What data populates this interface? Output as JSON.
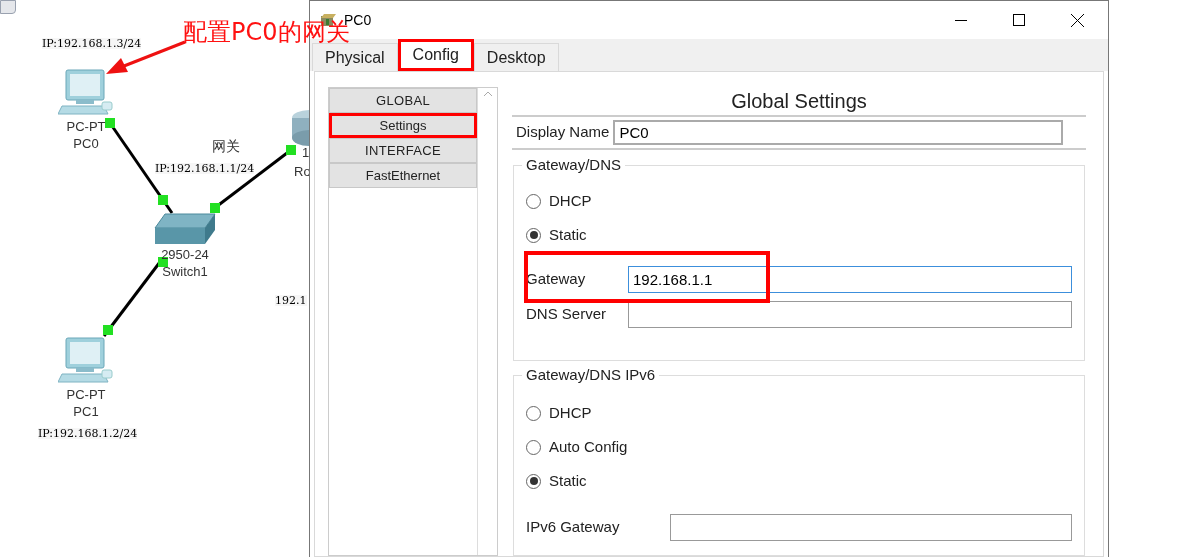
{
  "topology": {
    "annotation": "配置PC0的网关",
    "gateway_label": "网关",
    "gateway_ip": "IP:192.168.1.1/24",
    "devices": [
      {
        "kind": "pc",
        "model": "PC-PT",
        "name": "PC0",
        "ip": "IP:192.168.1.3/24"
      },
      {
        "kind": "switch",
        "model": "2950-24",
        "name": "Switch1"
      },
      {
        "kind": "pc",
        "model": "PC-PT",
        "name": "PC1",
        "ip": "IP:192.168.1.2/24"
      },
      {
        "kind": "router",
        "model": "1",
        "name": "Ro",
        "ip": "192.1"
      }
    ]
  },
  "window": {
    "title": "PC0",
    "tabs": [
      {
        "label": "Physical",
        "selected": false,
        "highlighted": false
      },
      {
        "label": "Config",
        "selected": true,
        "highlighted": true
      },
      {
        "label": "Desktop",
        "selected": false,
        "highlighted": false
      }
    ],
    "sidebar": [
      {
        "label": "GLOBAL",
        "kind": "header",
        "highlighted": false
      },
      {
        "label": "Settings",
        "kind": "item",
        "highlighted": true
      },
      {
        "label": "INTERFACE",
        "kind": "header",
        "highlighted": false
      },
      {
        "label": "FastEthernet",
        "kind": "item",
        "highlighted": false
      }
    ],
    "heading": "Global Settings",
    "display_name": {
      "label": "Display Name",
      "value": "PC0"
    },
    "groups": [
      {
        "title": "Gateway/DNS",
        "options": [
          {
            "label": "DHCP",
            "selected": false
          },
          {
            "label": "Static",
            "selected": true
          }
        ],
        "fields": [
          {
            "label": "Gateway",
            "value": "192.168.1.1",
            "focused": true,
            "highlighted": true
          },
          {
            "label": "DNS Server",
            "focused": false,
            "highlighted": false
          }
        ]
      },
      {
        "title": "Gateway/DNS IPv6",
        "options": [
          {
            "label": "DHCP",
            "selected": false
          },
          {
            "label": "Auto Config",
            "selected": false
          },
          {
            "label": "Static",
            "selected": true
          }
        ],
        "fields": [
          {
            "label": "IPv6 Gateway",
            "focused": false,
            "highlighted": false
          }
        ]
      }
    ]
  }
}
